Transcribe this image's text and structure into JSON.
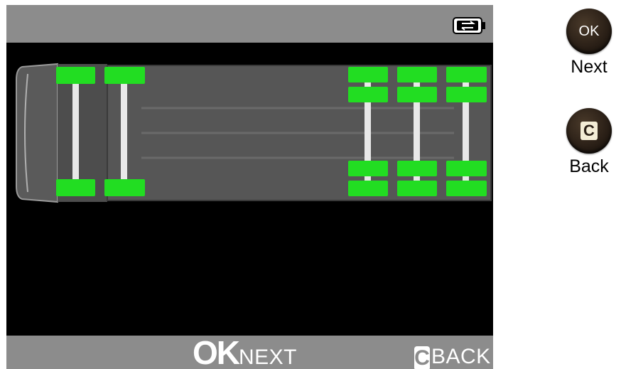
{
  "screen": {
    "ok_big": "OK",
    "next_label": "NEXT",
    "c_big": "C",
    "back_label": "BACK",
    "battery_icon": "battery-icon"
  },
  "side_keys": {
    "ok_key": "OK",
    "ok_caption": "Next",
    "c_key": "C",
    "c_caption": "Back"
  },
  "vehicle": {
    "type": "tractor-trailer",
    "front_axles": 2,
    "rear_axles": 3,
    "rear_dual_wheels": true,
    "tire_color": "#22dd22"
  },
  "colors": {
    "bar": "#8c8c8c",
    "screen_bg": "#000000",
    "tire": "#22dd22"
  }
}
